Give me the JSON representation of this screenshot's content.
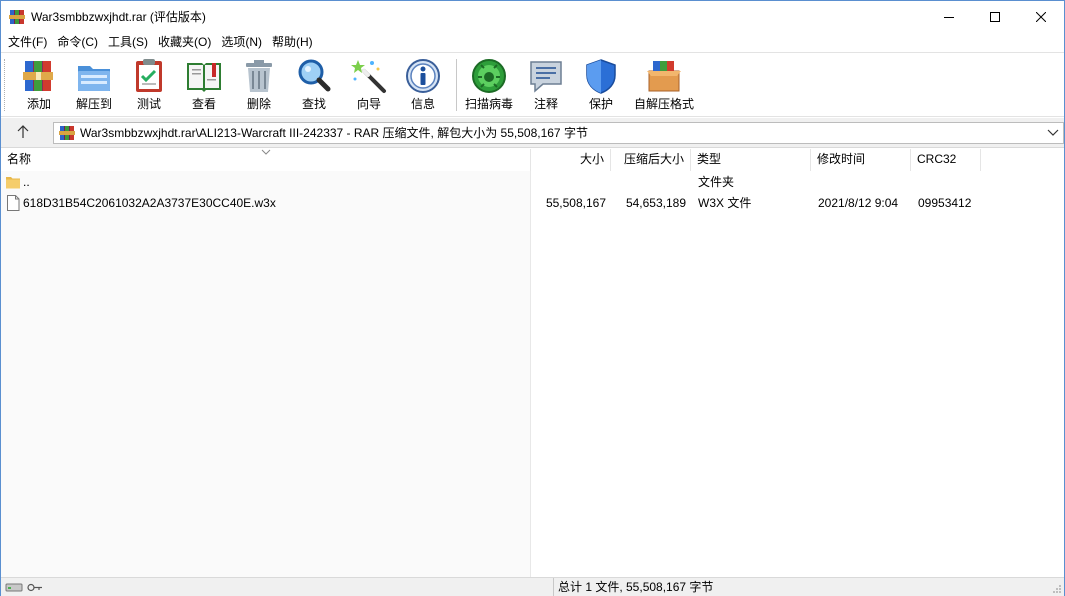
{
  "window": {
    "title": "War3smbbzwxjhdt.rar (评估版本)"
  },
  "menu": [
    {
      "label": "文件(F)"
    },
    {
      "label": "命令(C)"
    },
    {
      "label": "工具(S)"
    },
    {
      "label": "收藏夹(O)"
    },
    {
      "label": "选项(N)"
    },
    {
      "label": "帮助(H)"
    }
  ],
  "toolbar": {
    "buttons": [
      {
        "label": "添加",
        "icon": "add-archive-icon"
      },
      {
        "label": "解压到",
        "icon": "extract-folder-icon"
      },
      {
        "label": "测试",
        "icon": "test-clipboard-icon"
      },
      {
        "label": "查看",
        "icon": "view-book-icon"
      },
      {
        "label": "删除",
        "icon": "trash-icon"
      },
      {
        "label": "查找",
        "icon": "magnifier-icon"
      },
      {
        "label": "向导",
        "icon": "wizard-wand-icon"
      },
      {
        "label": "信息",
        "icon": "info-icon"
      },
      {
        "label": "扫描病毒",
        "icon": "virus-scan-icon"
      },
      {
        "label": "注释",
        "icon": "comment-icon"
      },
      {
        "label": "保护",
        "icon": "shield-icon"
      },
      {
        "label": "自解压格式",
        "icon": "sfx-box-icon"
      }
    ]
  },
  "address": {
    "path": "War3smbbzwxjhdt.rar\\ALI213-Warcraft III-242337 - RAR 压缩文件, 解包大小为 55,508,167 字节"
  },
  "columns": {
    "name": "名称",
    "size": "大小",
    "packed": "压缩后大小",
    "type": "类型",
    "modified": "修改时间",
    "crc": "CRC32"
  },
  "files": [
    {
      "name": "..",
      "size": "",
      "packed": "",
      "type": "文件夹",
      "modified": "",
      "crc": "",
      "icon": "folder-icon"
    },
    {
      "name": "618D31B54C2061032A2A3737E30CC40E.w3x",
      "size": "55,508,167",
      "packed": "54,653,189",
      "type": "W3X 文件",
      "modified": "2021/8/12 9:04",
      "crc": "09953412",
      "icon": "file-icon"
    }
  ],
  "status": {
    "text": "总计 1 文件, 55,508,167 字节"
  },
  "colors": {
    "accent": "#0078d7",
    "window_border": "#5a8fd0",
    "bar_bg": "#f0f0f0"
  }
}
